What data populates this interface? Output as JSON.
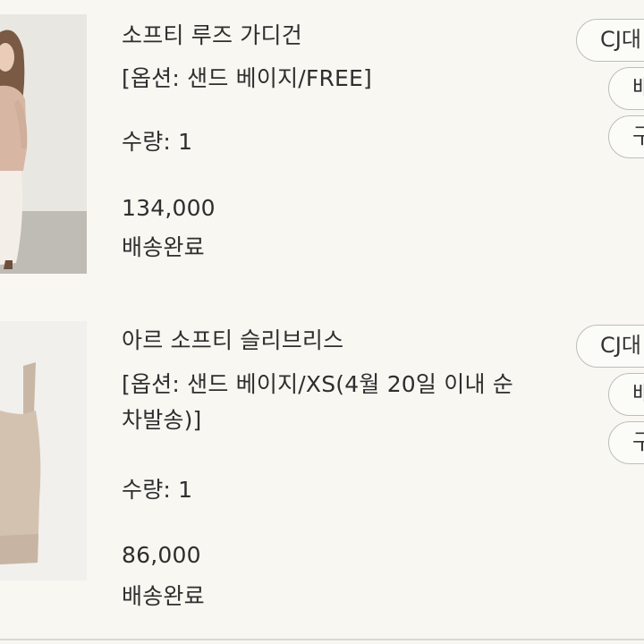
{
  "orders": [
    {
      "product_name": "소프티 루즈 가디건",
      "option": "[옵션: 샌드 베이지/FREE]",
      "quantity": "수량: 1",
      "price": "134,000",
      "status": "배송완료",
      "buttons": [
        "CJ대",
        "배",
        "구"
      ]
    },
    {
      "product_name": "아르 소프티 슬리브리스",
      "option": "[옵션: 샌드 베이지/XS(4월 20일 이내 순차발송)]",
      "quantity": "수량: 1",
      "price": "86,000",
      "status": "배송완료",
      "buttons": [
        "CJ대",
        "배",
        "구"
      ]
    }
  ],
  "colors": {
    "background": "#f8f7f2",
    "text": "#2e2e2e",
    "button_border": "#bdbdbd"
  }
}
